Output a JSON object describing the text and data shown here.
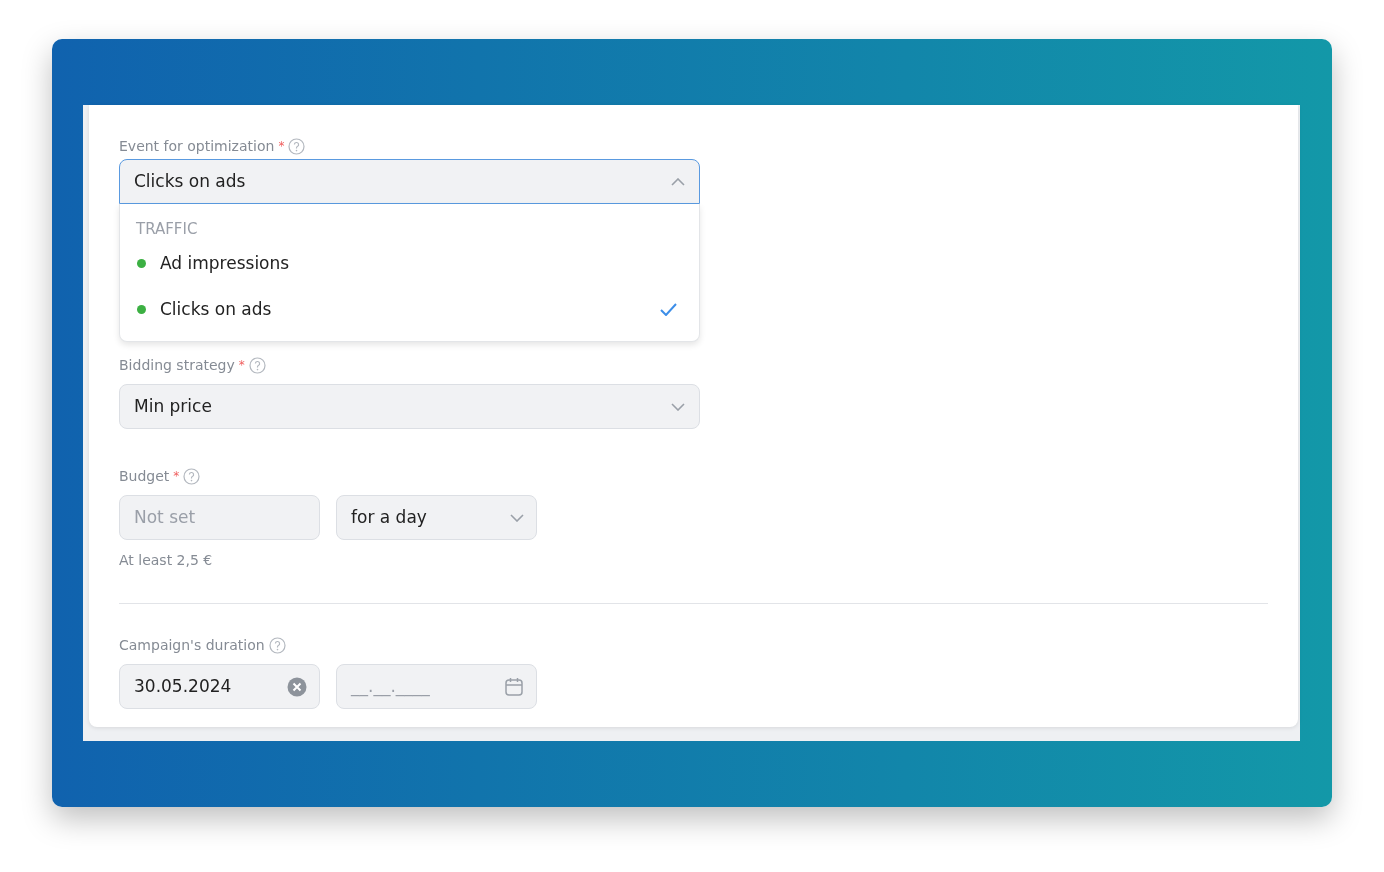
{
  "event_field": {
    "label": "Event for optimization",
    "required_mark": "*",
    "value": "Clicks on ads",
    "expanded": true,
    "menu": {
      "group": "TRAFFIC",
      "options": [
        {
          "label": "Ad impressions",
          "color": "#3cb043",
          "selected": false
        },
        {
          "label": "Clicks on ads",
          "color": "#3cb043",
          "selected": true
        }
      ]
    }
  },
  "bidding_field": {
    "label": "Bidding strategy",
    "required_mark": "*",
    "value": "Min price",
    "expanded": false
  },
  "budget_field": {
    "label": "Budget",
    "required_mark": "*",
    "amount": {
      "placeholder": "Not set"
    },
    "period": {
      "value": "for a day",
      "expanded": false
    },
    "hint": "At least 2,5 €"
  },
  "duration_field": {
    "label": "Campaign's duration",
    "start": {
      "value": "30.05.2024"
    },
    "end": {
      "placeholder": "__.__.____"
    }
  }
}
